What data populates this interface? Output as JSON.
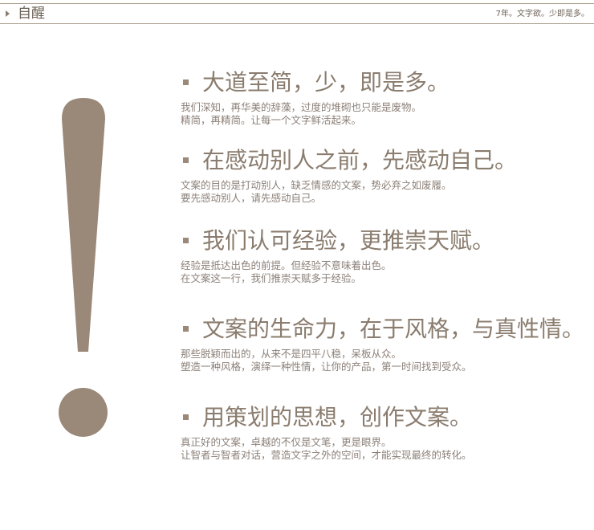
{
  "header": {
    "title": "自醒",
    "tagline": "7年。文字欲。少即是多。"
  },
  "items": [
    {
      "heading": "大道至简，少，即是多。",
      "line1": "我们深知，再华美的辞藻，过度的堆砌也只能是废物。",
      "line2": "精简，再精简。让每一个文字鲜活起来。"
    },
    {
      "heading": "在感动别人之前，先感动自己。",
      "line1": "文案的目的是打动别人，缺乏情感的文案，势必弃之如废履。",
      "line2": "要先感动别人，请先感动自己。"
    },
    {
      "heading": "我们认可经验，更推崇天赋。",
      "line1": "经验是抵达出色的前提。但经验不意味着出色。",
      "line2": "在文案这一行，我们推崇天赋多于经验。"
    },
    {
      "heading": "文案的生命力，在于风格，与真性情。",
      "line1": "那些脱颖而出的，从来不是四平八稳，呆板从众。",
      "line2": "塑造一种风格，演绎一种性情，让你的产品，第一时间找到受众。"
    },
    {
      "heading": "用策划的思想，创作文案。",
      "line1": "真正好的文案，卓越的不仅是文笔，更是眼界。",
      "line2": "让智者与智者对话，营造文字之外的空间，才能实现最终的转化。"
    }
  ],
  "colors": {
    "accent": "#9a8878",
    "text": "#8a7c6e",
    "border": "#a89a8b"
  }
}
